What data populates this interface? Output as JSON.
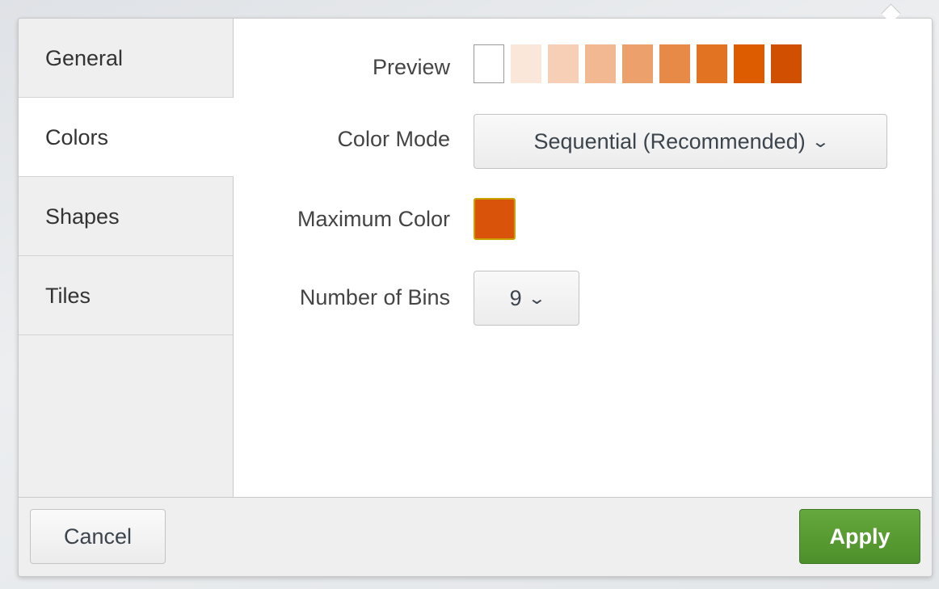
{
  "tabs": [
    {
      "label": "General",
      "active": false
    },
    {
      "label": "Colors",
      "active": true
    },
    {
      "label": "Shapes",
      "active": false
    },
    {
      "label": "Tiles",
      "active": false
    }
  ],
  "preview": {
    "label": "Preview",
    "swatch_colors": [
      "#ffffff",
      "#fbe6da",
      "#f6cfb6",
      "#f1b891",
      "#eca16c",
      "#e78a47",
      "#e27322",
      "#dd5c00",
      "#d04f00"
    ]
  },
  "color_mode": {
    "label": "Color Mode",
    "value": "Sequential (Recommended)",
    "chevron_icon": "chevron-down-icon"
  },
  "maximum_color": {
    "label": "Maximum Color",
    "color": "#d9540a"
  },
  "bins": {
    "label": "Number of Bins",
    "value": "9",
    "chevron_icon": "chevron-down-icon"
  },
  "footer": {
    "cancel_label": "Cancel",
    "apply_label": "Apply",
    "apply_color": "#559a31"
  }
}
